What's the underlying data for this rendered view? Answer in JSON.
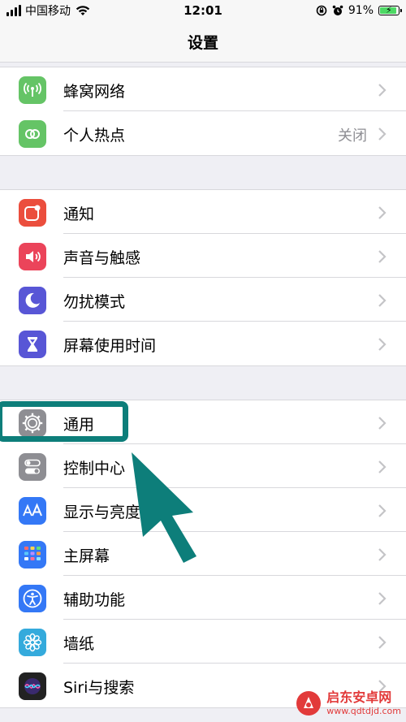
{
  "status_bar": {
    "carrier": "中国移动",
    "time": "12:01",
    "battery_percent": "91%",
    "battery_level": 0.91
  },
  "nav": {
    "title": "设置"
  },
  "groups": [
    [
      {
        "label": "蜂窝网络",
        "icon": "cellular-antenna-icon",
        "color": "#65c466",
        "value": ""
      },
      {
        "label": "个人热点",
        "icon": "personal-hotspot-icon",
        "color": "#65c466",
        "value": "关闭"
      }
    ],
    [
      {
        "label": "通知",
        "icon": "notifications-icon",
        "color": "#eb4e3d",
        "value": ""
      },
      {
        "label": "声音与触感",
        "icon": "speaker-icon",
        "color": "#eb445a",
        "value": ""
      },
      {
        "label": "勿扰模式",
        "icon": "moon-icon",
        "color": "#5856d6",
        "value": ""
      },
      {
        "label": "屏幕使用时间",
        "icon": "hourglass-icon",
        "color": "#5856d6",
        "value": ""
      }
    ],
    [
      {
        "label": "通用",
        "icon": "gear-icon",
        "color": "#8e8e93",
        "value": ""
      },
      {
        "label": "控制中心",
        "icon": "toggle-switches-icon",
        "color": "#8e8e93",
        "value": ""
      },
      {
        "label": "显示与亮度",
        "icon": "text-size-icon",
        "color": "#3478f6",
        "value": ""
      },
      {
        "label": "主屏幕",
        "icon": "home-grid-icon",
        "color": "#3478f6",
        "value": ""
      },
      {
        "label": "辅助功能",
        "icon": "accessibility-icon",
        "color": "#3478f6",
        "value": ""
      },
      {
        "label": "墙纸",
        "icon": "flower-icon",
        "color": "#34aadc",
        "value": ""
      },
      {
        "label": "Siri与搜索",
        "icon": "siri-icon",
        "color": "#222222",
        "value": ""
      }
    ]
  ],
  "watermark": {
    "name": "启东安卓网",
    "url": "www.qdtdjd.com"
  },
  "annotation_color": "#0d7e7a"
}
